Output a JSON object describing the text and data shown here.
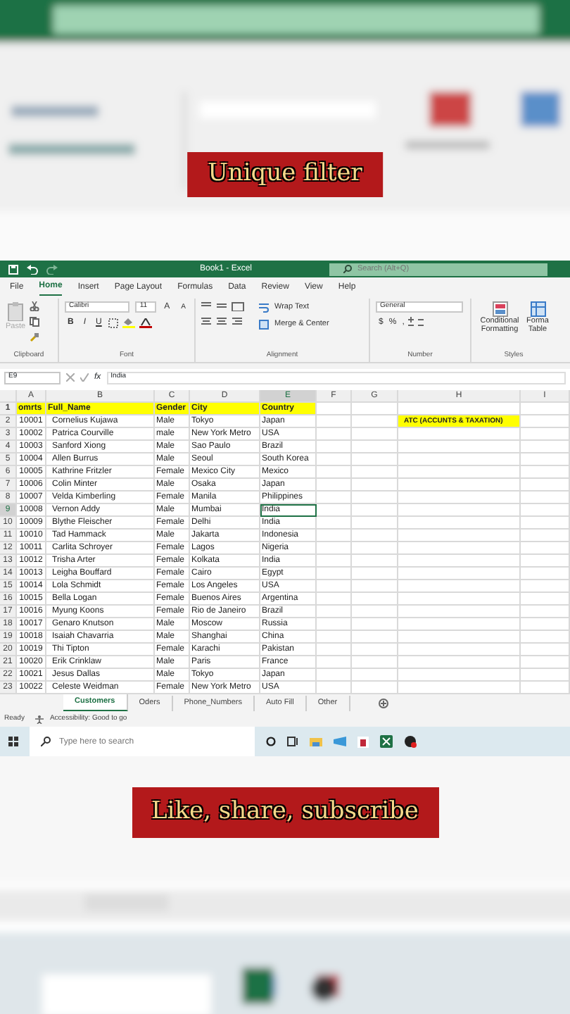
{
  "top_caption": "Unique filter",
  "title_bar": {
    "title": "Book1 - Excel",
    "search_placeholder": "Search (Alt+Q)"
  },
  "ribbon_tabs": [
    {
      "label": "File",
      "selected": false
    },
    {
      "label": "Home",
      "selected": true
    },
    {
      "label": "Insert",
      "selected": false
    },
    {
      "label": "Page Layout",
      "selected": false
    },
    {
      "label": "Formulas",
      "selected": false
    },
    {
      "label": "Data",
      "selected": false
    },
    {
      "label": "Review",
      "selected": false
    },
    {
      "label": "View",
      "selected": false
    },
    {
      "label": "Help",
      "selected": false
    }
  ],
  "ribbon": {
    "paste": "Paste",
    "font_name": "Calibri",
    "font_size": "11",
    "font_size_buttons": [
      "A",
      "A"
    ],
    "font_buttons": [
      "B",
      "I",
      "U"
    ],
    "wrap_text": "Wrap Text",
    "merge": "Merge & Center",
    "number_format": "General",
    "number_buttons": [
      "$",
      "%",
      ","
    ],
    "conditional_formatting": "Conditional Formatting",
    "format_table": "Forma Table",
    "groups": [
      "Clipboard",
      "Font",
      "Alignment",
      "Number",
      "Styles"
    ]
  },
  "formula_bar": {
    "cell": "E9",
    "fx": "fx",
    "value": "India"
  },
  "sheet": {
    "columns": [
      {
        "label": "A",
        "selected": false
      },
      {
        "label": "B",
        "selected": false
      },
      {
        "label": "C",
        "selected": false
      },
      {
        "label": "D",
        "selected": false
      },
      {
        "label": "E",
        "selected": true
      },
      {
        "label": "F",
        "selected": false
      },
      {
        "label": "G",
        "selected": false
      },
      {
        "label": "H",
        "selected": false
      },
      {
        "label": "I",
        "selected": false
      }
    ],
    "rows": [
      {
        "number": "1",
        "header": true,
        "selected": false,
        "cells": [
          "omrts",
          "Full_Name",
          "Gender",
          "City",
          "Country"
        ]
      },
      {
        "number": "2",
        "header": false,
        "selected": false,
        "cells": [
          "10001",
          "Cornelius Kujawa",
          "Male",
          "Tokyo",
          "Japan"
        ],
        "column_h": "ATC (ACCUNTS & TAXATION)"
      },
      {
        "number": "3",
        "header": false,
        "selected": false,
        "cells": [
          "10002",
          "Patrica Courville",
          "male",
          "New York Metro",
          "USA"
        ]
      },
      {
        "number": "4",
        "header": false,
        "selected": false,
        "cells": [
          "10003",
          "Sanford Xiong",
          "Male",
          "Sao Paulo",
          "Brazil"
        ]
      },
      {
        "number": "5",
        "header": false,
        "selected": false,
        "cells": [
          "10004",
          "Allen Burrus",
          "Male",
          "Seoul",
          "South Korea"
        ]
      },
      {
        "number": "6",
        "header": false,
        "selected": false,
        "cells": [
          "10005",
          "Kathrine Fritzler",
          "Female",
          "Mexico City",
          "Mexico"
        ]
      },
      {
        "number": "7",
        "header": false,
        "selected": false,
        "cells": [
          "10006",
          "Colin Minter",
          "Male",
          "Osaka",
          "Japan"
        ]
      },
      {
        "number": "8",
        "header": false,
        "selected": false,
        "cells": [
          "10007",
          "Velda Kimberling",
          "Female",
          "Manila",
          "Philippines"
        ]
      },
      {
        "number": "9",
        "header": false,
        "selected": true,
        "cells": [
          "10008",
          "Vernon Addy",
          "Male",
          "Mumbai",
          "India"
        ]
      },
      {
        "number": "10",
        "header": false,
        "selected": false,
        "cells": [
          "10009",
          "Blythe Fleischer",
          "Female",
          "Delhi",
          "India"
        ]
      },
      {
        "number": "11",
        "header": false,
        "selected": false,
        "cells": [
          "10010",
          "Tad Hammack",
          "Male",
          "Jakarta",
          "Indonesia"
        ]
      },
      {
        "number": "12",
        "header": false,
        "selected": false,
        "cells": [
          "10011",
          "Carlita Schroyer",
          "Female",
          "Lagos",
          "Nigeria"
        ]
      },
      {
        "number": "13",
        "header": false,
        "selected": false,
        "cells": [
          "10012",
          "Trisha Arter",
          "Female",
          "Kolkata",
          "India"
        ]
      },
      {
        "number": "14",
        "header": false,
        "selected": false,
        "cells": [
          "10013",
          "Leigha Bouffard",
          "Female",
          "Cairo",
          "Egypt"
        ]
      },
      {
        "number": "15",
        "header": false,
        "selected": false,
        "cells": [
          "10014",
          "Lola Schmidt",
          "Female",
          "Los Angeles",
          "USA"
        ]
      },
      {
        "number": "16",
        "header": false,
        "selected": false,
        "cells": [
          "10015",
          "Bella Logan",
          "Female",
          "Buenos Aires",
          "Argentina"
        ]
      },
      {
        "number": "17",
        "header": false,
        "selected": false,
        "cells": [
          "10016",
          "Myung Koons",
          "Female",
          "Rio de Janeiro",
          "Brazil"
        ]
      },
      {
        "number": "18",
        "header": false,
        "selected": false,
        "cells": [
          "10017",
          "Genaro Knutson",
          "Male",
          "Moscow",
          "Russia"
        ]
      },
      {
        "number": "19",
        "header": false,
        "selected": false,
        "cells": [
          "10018",
          "Isaiah Chavarria",
          "Male",
          "Shanghai",
          "China"
        ]
      },
      {
        "number": "20",
        "header": false,
        "selected": false,
        "cells": [
          "10019",
          "Thi Tipton",
          "Female",
          "Karachi",
          "Pakistan"
        ]
      },
      {
        "number": "21",
        "header": false,
        "selected": false,
        "cells": [
          "10020",
          "Erik Crinklaw",
          "Male",
          "Paris",
          "France"
        ]
      },
      {
        "number": "22",
        "header": false,
        "selected": false,
        "cells": [
          "10021",
          "Jesus Dallas",
          "Male",
          "Tokyo",
          "Japan"
        ]
      },
      {
        "number": "23",
        "header": false,
        "selected": false,
        "cells": [
          "10022",
          "Celeste Weidman",
          "Female",
          "New York Metro",
          "USA"
        ]
      }
    ]
  },
  "sheet_tabs": [
    {
      "label": "Customers",
      "selected": true
    },
    {
      "label": "Oders",
      "selected": false
    },
    {
      "label": "Phone_Numbers",
      "selected": false
    },
    {
      "label": "Auto Fill",
      "selected": false
    },
    {
      "label": "Other",
      "selected": false
    }
  ],
  "status_bar": {
    "mode": "Ready",
    "accessibility": "Accessibility: Good to go"
  },
  "taskbar": {
    "search_placeholder": "Type here to search"
  },
  "bottom_caption": "Like, share, subscribe"
}
